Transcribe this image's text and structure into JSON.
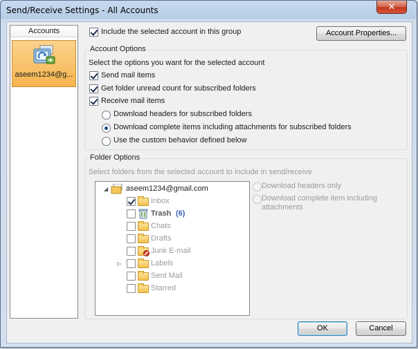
{
  "window": {
    "title": "Send/Receive Settings - All Accounts"
  },
  "accounts_panel": {
    "header": "Accounts",
    "account_name": "aseem1234@g..."
  },
  "include_account": {
    "label": "Include the selected account in this group",
    "checked": true
  },
  "buttons": {
    "account_properties": "Account Properties...",
    "ok": "OK",
    "cancel": "Cancel"
  },
  "account_options": {
    "title": "Account Options",
    "description": "Select the options you want for the selected account",
    "send_mail": {
      "label": "Send mail items",
      "checked": true
    },
    "unread_count": {
      "label": "Get folder unread count for subscribed folders",
      "checked": true
    },
    "receive_mail": {
      "label": "Receive mail items",
      "checked": true
    },
    "receive_options": [
      {
        "label": "Download headers for subscribed folders",
        "selected": false
      },
      {
        "label": "Download complete items including attachments for subscribed folders",
        "selected": true
      },
      {
        "label": "Use the custom behavior defined below",
        "selected": false
      }
    ]
  },
  "folder_options": {
    "title": "Folder Options",
    "description": "Select folders from the selected account to include in send/receive",
    "root": "aseem1234@gmail.com",
    "folders": [
      {
        "name": "Inbox",
        "checked": true,
        "icon": "inbox-folder-icon"
      },
      {
        "name": "Trash",
        "count": "(6)",
        "checked": false,
        "icon": "trash-icon",
        "bold": true
      },
      {
        "name": "Chats",
        "checked": false,
        "icon": "folder-icon"
      },
      {
        "name": "Drafts",
        "checked": false,
        "icon": "folder-icon"
      },
      {
        "name": "Junk E-mail",
        "checked": false,
        "icon": "junk-folder-icon"
      },
      {
        "name": "Labels",
        "checked": false,
        "icon": "folder-icon",
        "expandable": true
      },
      {
        "name": "Sent Mail",
        "checked": false,
        "icon": "folder-icon"
      },
      {
        "name": "Starred",
        "checked": false,
        "icon": "folder-icon"
      }
    ],
    "download_options": [
      {
        "label": "Download headers only"
      },
      {
        "label": "Download complete item including",
        "label2": "attachments"
      }
    ]
  }
}
